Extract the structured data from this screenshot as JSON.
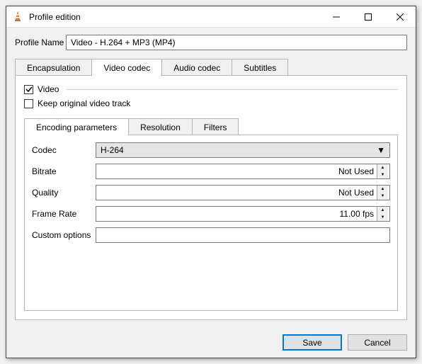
{
  "window": {
    "title": "Profile edition"
  },
  "profile": {
    "label": "Profile Name",
    "value": "Video - H.264 + MP3 (MP4)"
  },
  "tabs": {
    "encapsulation": "Encapsulation",
    "video_codec": "Video codec",
    "audio_codec": "Audio codec",
    "subtitles": "Subtitles"
  },
  "video": {
    "checkbox_label": "Video",
    "keep_original": "Keep original video track"
  },
  "inner_tabs": {
    "encoding": "Encoding parameters",
    "resolution": "Resolution",
    "filters": "Filters"
  },
  "fields": {
    "codec": {
      "label": "Codec",
      "value": "H-264"
    },
    "bitrate": {
      "label": "Bitrate",
      "value": "Not Used"
    },
    "quality": {
      "label": "Quality",
      "value": "Not Used"
    },
    "framerate": {
      "label": "Frame Rate",
      "value": "11.00 fps"
    },
    "custom": {
      "label": "Custom options",
      "value": ""
    }
  },
  "buttons": {
    "save": "Save",
    "cancel": "Cancel"
  }
}
